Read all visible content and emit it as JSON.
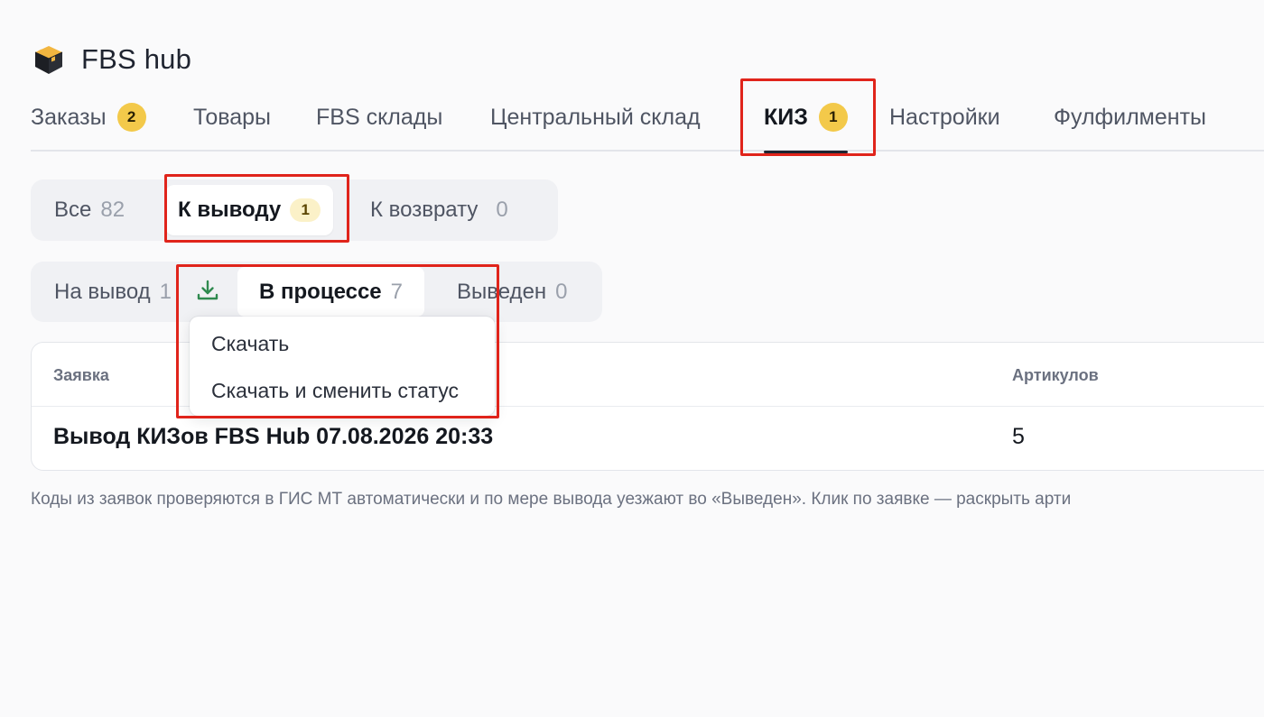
{
  "app": {
    "title": "FBS hub",
    "logo_icon": "package-box-icon"
  },
  "topnav": {
    "tabs": [
      {
        "label": "Заказы",
        "badge": "2"
      },
      {
        "label": "Товары"
      },
      {
        "label": "FBS склады"
      },
      {
        "label": "Центральный склад"
      },
      {
        "label": "КИЗ",
        "badge": "1",
        "active": true
      },
      {
        "label": "Настройки"
      },
      {
        "label": "Фулфилменты"
      }
    ]
  },
  "filter_primary": {
    "items": [
      {
        "label": "Все",
        "count": "82"
      },
      {
        "label": "К выводу",
        "badge": "1",
        "active": true
      },
      {
        "label": "К возврату",
        "count": "0"
      }
    ]
  },
  "filter_status": {
    "items": [
      {
        "label": "На вывод",
        "count": "1"
      },
      {
        "label": "В процессе",
        "count": "7",
        "active": true
      },
      {
        "label": "Выведен",
        "count": "0"
      }
    ],
    "download_icon": "download-icon"
  },
  "dropdown": {
    "options": [
      "Скачать",
      "Скачать и сменить статус"
    ]
  },
  "table": {
    "columns": [
      "Заявка",
      "Артикулов"
    ],
    "rows": [
      {
        "name": "Вывод КИЗов FBS Hub 07.08.2026 20:33",
        "articles": "5"
      }
    ]
  },
  "footnote": "Коды из заявок проверяются в ГИС МТ автоматически и по мере вывода уезжают во «Выведен». Клик по заявке — раскрыть арти",
  "colors": {
    "badge_yellow": "#f3c94a",
    "badge_soft": "#fbf1c8",
    "annotation_red": "#e0241b",
    "download_green": "#2f8a4f"
  }
}
